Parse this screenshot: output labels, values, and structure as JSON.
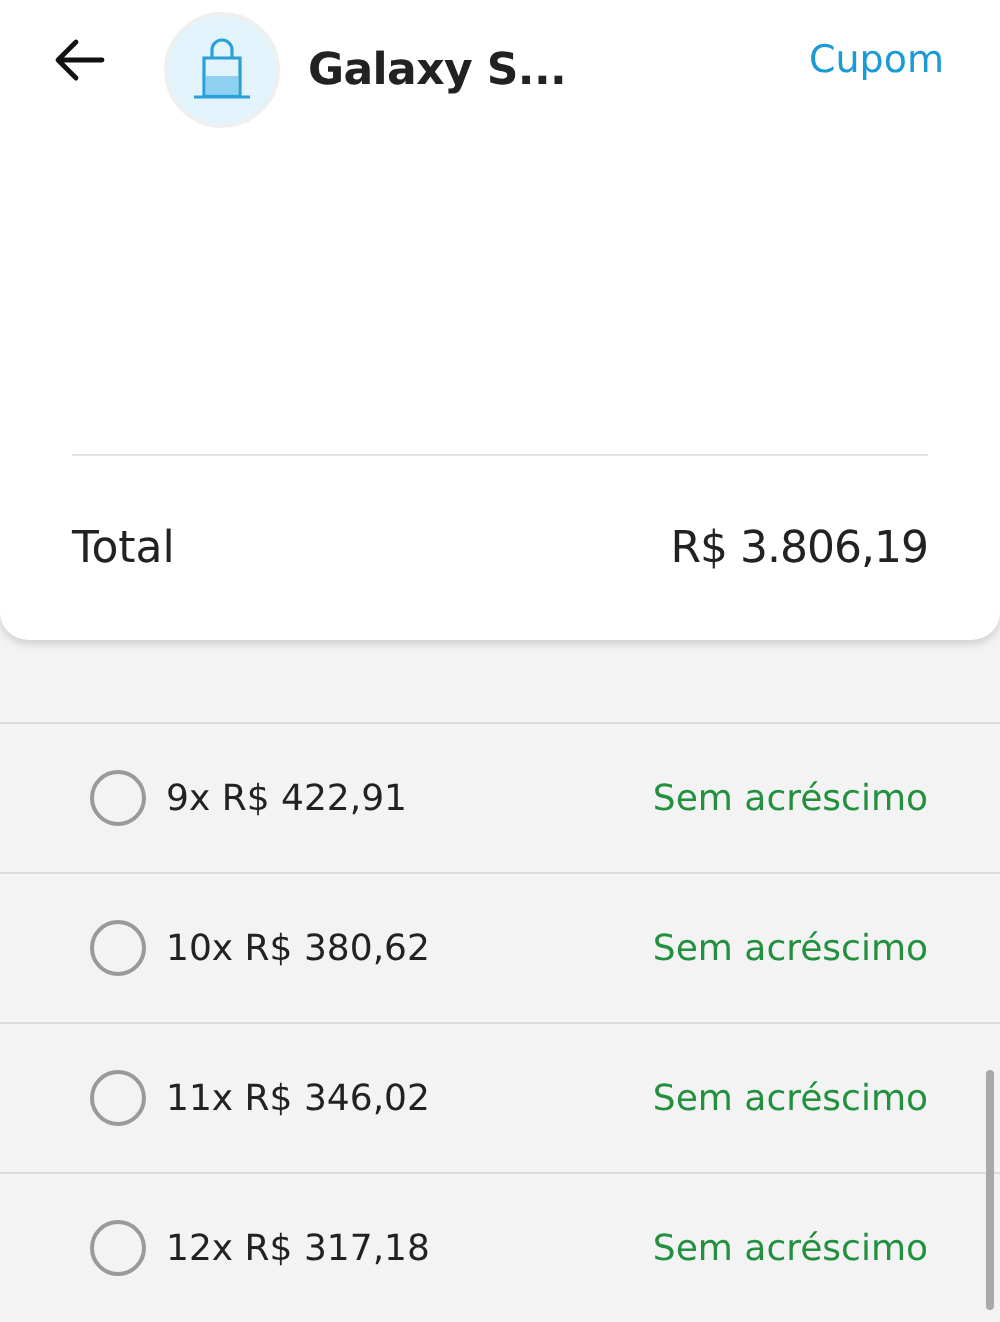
{
  "header": {
    "title": "Galaxy S...",
    "action": "Cupom"
  },
  "summary": {
    "label": "Total",
    "value": "R$ 3.806,19"
  },
  "installments": [
    {
      "label": "9x R$ 422,91",
      "note": "Sem acréscimo",
      "selected": false
    },
    {
      "label": "10x R$ 380,62",
      "note": "Sem acréscimo",
      "selected": false
    },
    {
      "label": "11x R$ 346,02",
      "note": "Sem acréscimo",
      "selected": false
    },
    {
      "label": "12x R$ 317,18",
      "note": "Sem acréscimo",
      "selected": false
    }
  ]
}
